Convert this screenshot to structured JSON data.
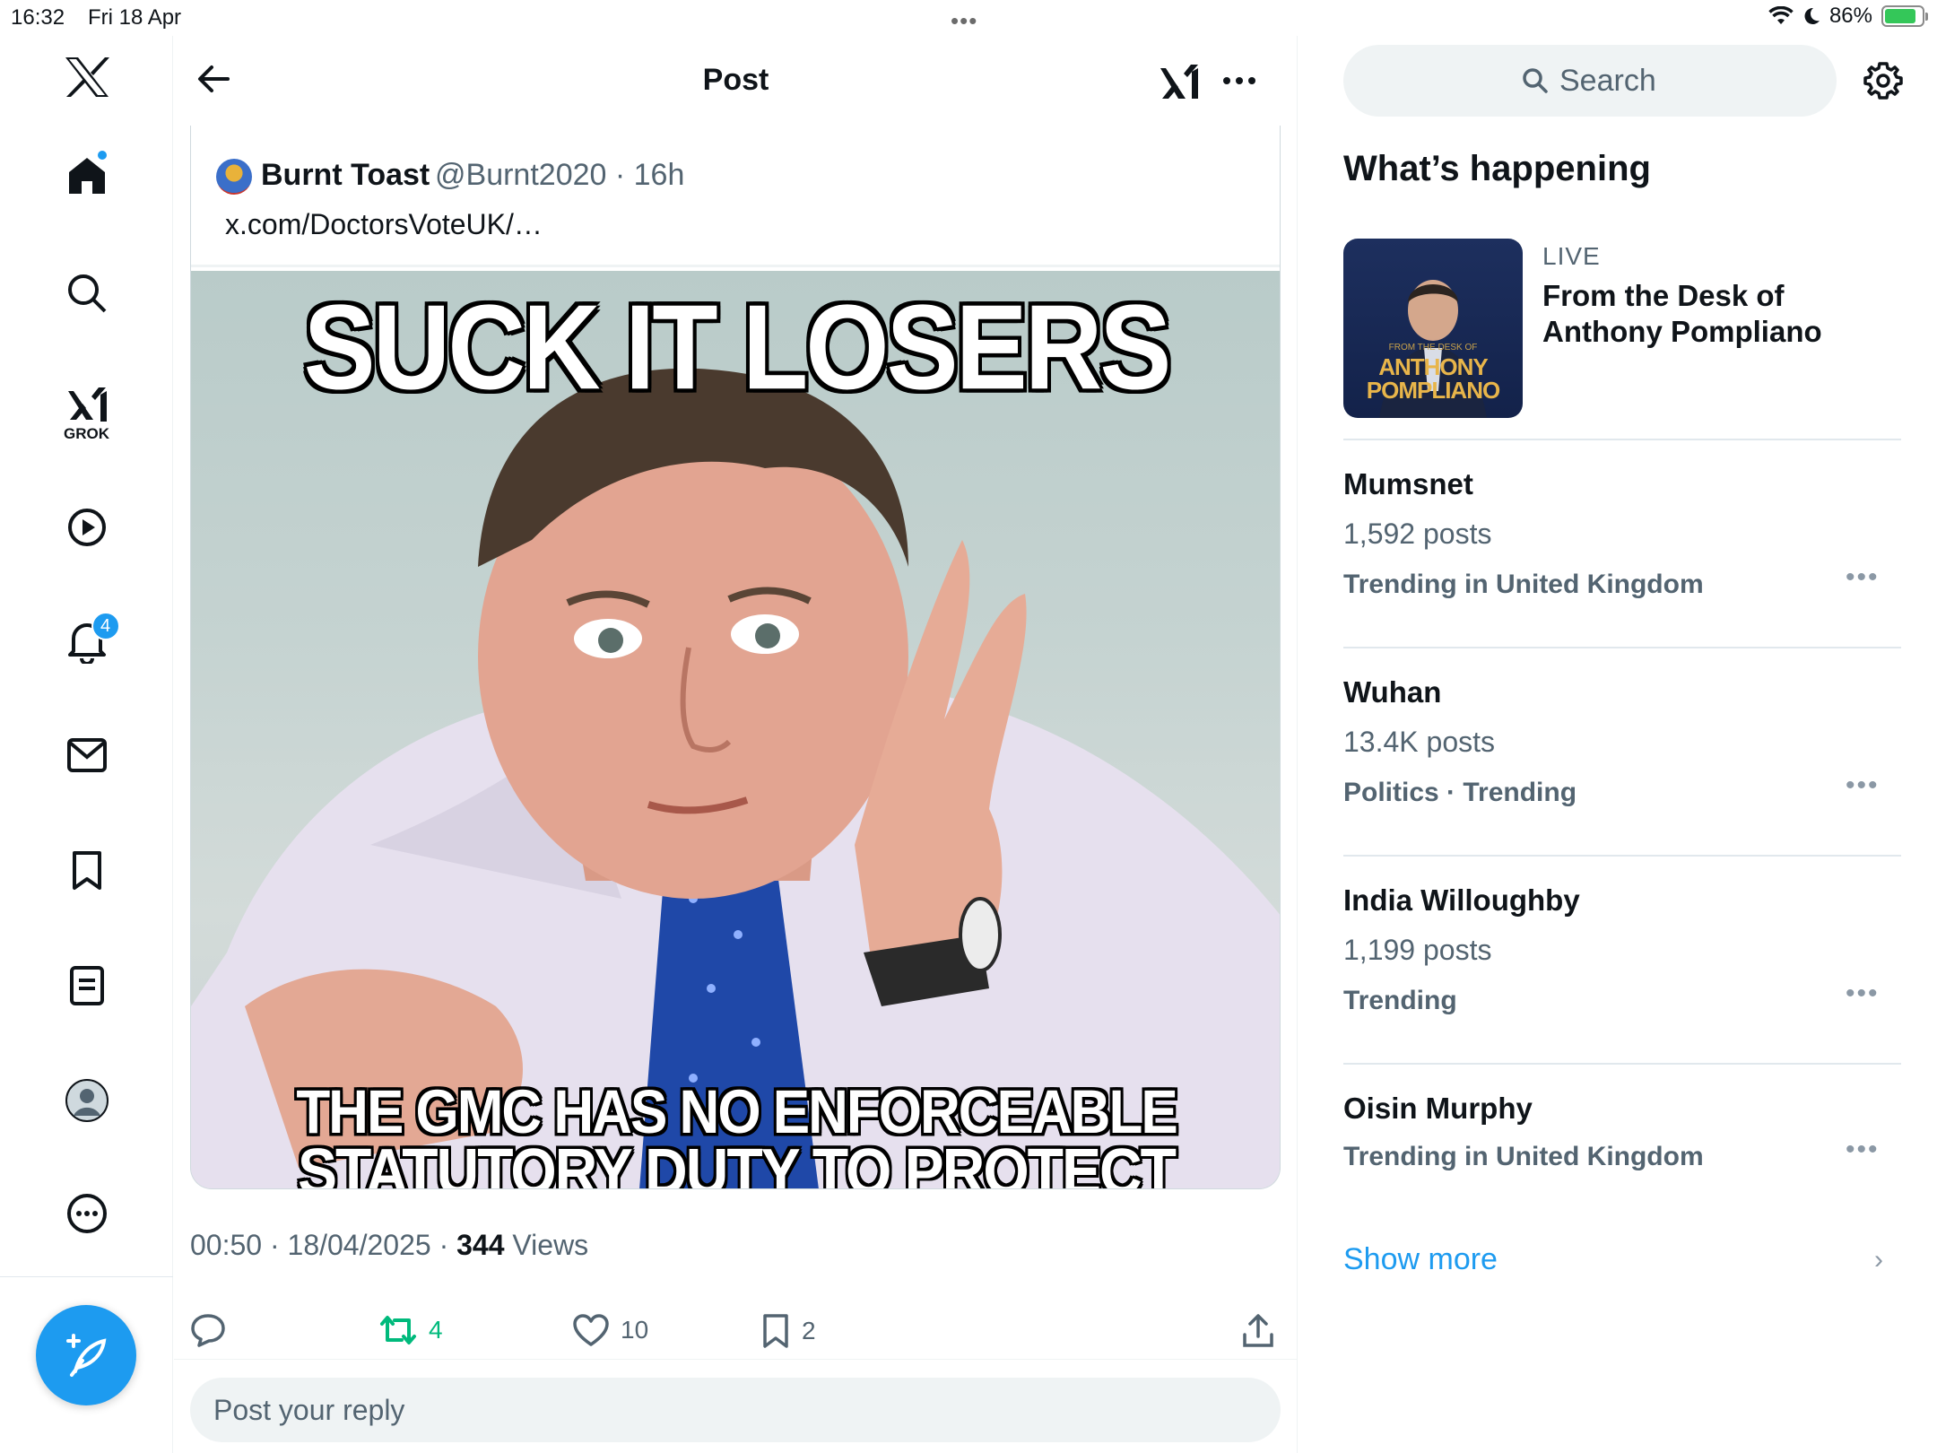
{
  "status_bar": {
    "time": "16:32",
    "date": "Fri 18 Apr",
    "battery": "86%",
    "battery_level": 0.86
  },
  "nav": {
    "items": [
      "x-logo",
      "home",
      "explore",
      "grok",
      "video",
      "notifications",
      "messages",
      "bookmarks",
      "lists",
      "profile",
      "more"
    ],
    "grok_label": "GROK",
    "notifications_count": "4",
    "accent": "#1d9bf0"
  },
  "header": {
    "title": "Post"
  },
  "quoted_post": {
    "name": "Burnt Toast",
    "handle": "@Burnt2020 · 16h",
    "text": "x.com/DoctorsVoteUK/…",
    "meme_top": "SUCK IT LOSERS",
    "meme_bottom_1": "THE GMC HAS NO ENFORCEABLE",
    "meme_bottom_2": "STATUTORY DUTY TO PROTECT PATIENT SAFETY"
  },
  "post_meta": {
    "time_date": "00:50 · 18/04/2025 · ",
    "views_count": "344",
    "views_label": " Views"
  },
  "actions": {
    "retweets": "4",
    "likes": "10",
    "bookmarks": "2"
  },
  "reply": {
    "placeholder": "Post your reply"
  },
  "sidebar": {
    "search_placeholder": "Search",
    "section_title": "What’s happening",
    "live": {
      "tag": "LIVE",
      "title": "From the Desk of Anthony Pompliano",
      "thumb_small": "FROM THE DESK OF",
      "thumb_line1": "ANTHONY",
      "thumb_line2": "POMPLIANO"
    },
    "trends": [
      {
        "name": "Mumsnet",
        "posts": "1,592 posts",
        "meta": "Trending in United Kingdom"
      },
      {
        "name": "Wuhan",
        "posts": "13.4K posts",
        "meta": "Politics · Trending"
      },
      {
        "name": "India Willoughby",
        "posts": "1,199 posts",
        "meta": "Trending"
      },
      {
        "name": "Oisin Murphy",
        "posts": "",
        "meta": "Trending in United Kingdom"
      }
    ],
    "show_more": "Show more"
  }
}
